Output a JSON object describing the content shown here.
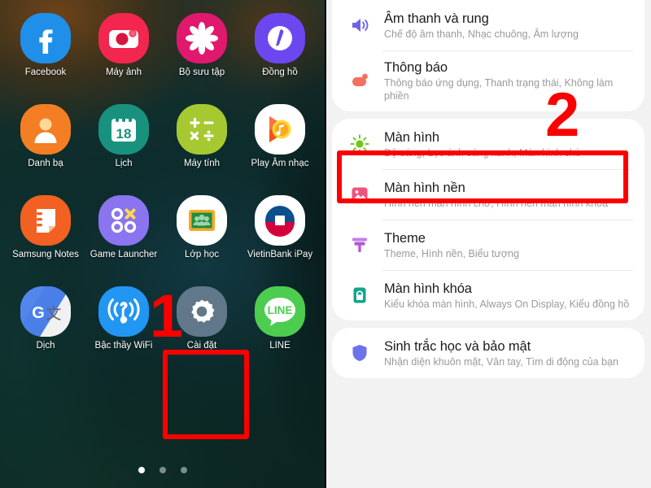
{
  "home": {
    "apps": [
      [
        {
          "label": "Facebook",
          "icon": "facebook-icon"
        },
        {
          "label": "Máy ảnh",
          "icon": "camera-icon"
        },
        {
          "label": "Bộ sưu tập",
          "icon": "gallery-icon"
        },
        {
          "label": "Đồng hồ",
          "icon": "clock-icon"
        }
      ],
      [
        {
          "label": "Danh bạ",
          "icon": "contacts-icon"
        },
        {
          "label": "Lịch",
          "icon": "calendar-icon"
        },
        {
          "label": "Máy tính",
          "icon": "calculator-icon"
        },
        {
          "label": "Play Âm nhạc",
          "icon": "play-music-icon"
        }
      ],
      [
        {
          "label": "Samsung Notes",
          "icon": "samsung-notes-icon"
        },
        {
          "label": "Game Launcher",
          "icon": "game-launcher-icon"
        },
        {
          "label": "Lớp học",
          "icon": "google-classroom-icon"
        },
        {
          "label": "VietinBank iPay",
          "icon": "vietinbank-icon"
        }
      ],
      [
        {
          "label": "Dịch",
          "icon": "google-translate-icon"
        },
        {
          "label": "Bậc thầy WiFi",
          "icon": "wifi-master-icon"
        },
        {
          "label": "Cài đặt",
          "icon": "settings-gear-icon"
        },
        {
          "label": "LINE",
          "icon": "line-icon"
        }
      ]
    ],
    "calendar_day": "18",
    "page_dots": {
      "count": 3,
      "active_index": 0
    }
  },
  "settings": {
    "groups": [
      {
        "rows": [
          {
            "title": "Âm thanh và rung",
            "sub": "Chế độ âm thanh, Nhạc chuông, Âm lượng",
            "icon": "sound-speaker-icon",
            "color": "#6C63E8"
          },
          {
            "title": "Thông báo",
            "sub": "Thông báo ứng dụng, Thanh trạng thái, Không làm phiền",
            "icon": "notification-bubble-icon",
            "color": "#F4705F"
          }
        ]
      },
      {
        "rows": [
          {
            "title": "Màn hình",
            "sub": "Độ sáng, Lọc ánh sáng xanh, Màn hình chờ",
            "icon": "brightness-sun-icon",
            "color": "#6DC81B"
          },
          {
            "title": "Màn hình nền",
            "sub": "Hình nền màn hình chờ, Hình nền màn hình khóa",
            "icon": "wallpaper-image-icon",
            "color": "#F0527E"
          },
          {
            "title": "Theme",
            "sub": "Theme, Hình nền, Biểu tượng",
            "icon": "theme-paint-roller-icon",
            "color": "#B357DC"
          },
          {
            "title": "Màn hình khóa",
            "sub": "Kiểu khóa màn hình, Always On Display, Kiểu đồng hồ",
            "icon": "lock-screen-icon",
            "color": "#13A58C"
          }
        ]
      },
      {
        "rows": [
          {
            "title": "Sinh trắc học và bảo mật",
            "sub": "Nhận diện khuôn mặt, Vân tay, Tìm di động của bạn",
            "icon": "security-shield-icon",
            "color": "#6B74E8"
          }
        ]
      }
    ]
  },
  "annotations": {
    "step1_label": "1",
    "step2_label": "2",
    "highlight_color": "#FB0000",
    "step1_target": "Cài đặt",
    "step2_target": "Màn hình"
  }
}
